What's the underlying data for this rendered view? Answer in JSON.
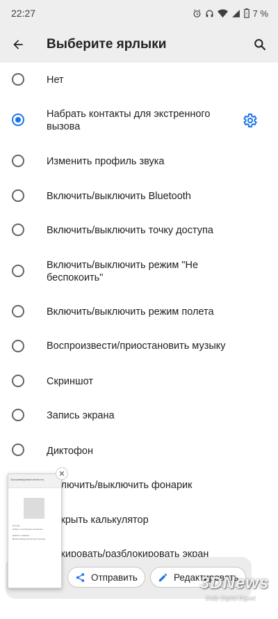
{
  "status_bar": {
    "time": "22:27",
    "battery_percent": "7 %",
    "icons": [
      "alarm-icon",
      "headphones-icon",
      "wifi-icon",
      "signal-icon",
      "battery-icon"
    ]
  },
  "app_bar": {
    "title": "Выберите ярлыки",
    "back_icon": "arrow-back-icon",
    "search_icon": "search-icon"
  },
  "items": [
    {
      "label": "Нет",
      "checked": false
    },
    {
      "label": "Набрать контакты для экстренного вызова",
      "checked": true,
      "has_settings": true
    },
    {
      "label": "Изменить профиль звука",
      "checked": false
    },
    {
      "label": "Включить/выключить Bluetooth",
      "checked": false
    },
    {
      "label": "Включить/выключить точку доступа",
      "checked": false
    },
    {
      "label": "Включить/выключить режим \"Не беспокоить\"",
      "checked": false
    },
    {
      "label": "Включить/выключить режим полета",
      "checked": false
    },
    {
      "label": "Воспроизвести/приостановить музыку",
      "checked": false
    },
    {
      "label": "Скриншот",
      "checked": false
    },
    {
      "label": "Запись экрана",
      "checked": false
    },
    {
      "label": "Диктофон",
      "checked": false
    },
    {
      "label": "…лючить/выключить фонарик",
      "checked": false
    },
    {
      "label": "…крыть калькулятор",
      "checked": false
    },
    {
      "label": "…кировать/разблокировать экран",
      "checked": false
    }
  ],
  "screenshot_preview": {
    "header_text": "Программируемые кнопки на...",
    "line1": "Ручной",
    "line2": "Набор и сообщения контактам...",
    "line3": "Действ. в камере",
    "line4": "Вызов набора контактов и прочее"
  },
  "share_actions": {
    "send_label": "Отправить",
    "edit_label": "Редактировать"
  },
  "watermark": {
    "main": "3DNews",
    "sub": "Daily Digital Digest"
  },
  "colors": {
    "accent": "#1a73e8",
    "app_bar_bg": "#eeeeee",
    "text": "#202124"
  }
}
